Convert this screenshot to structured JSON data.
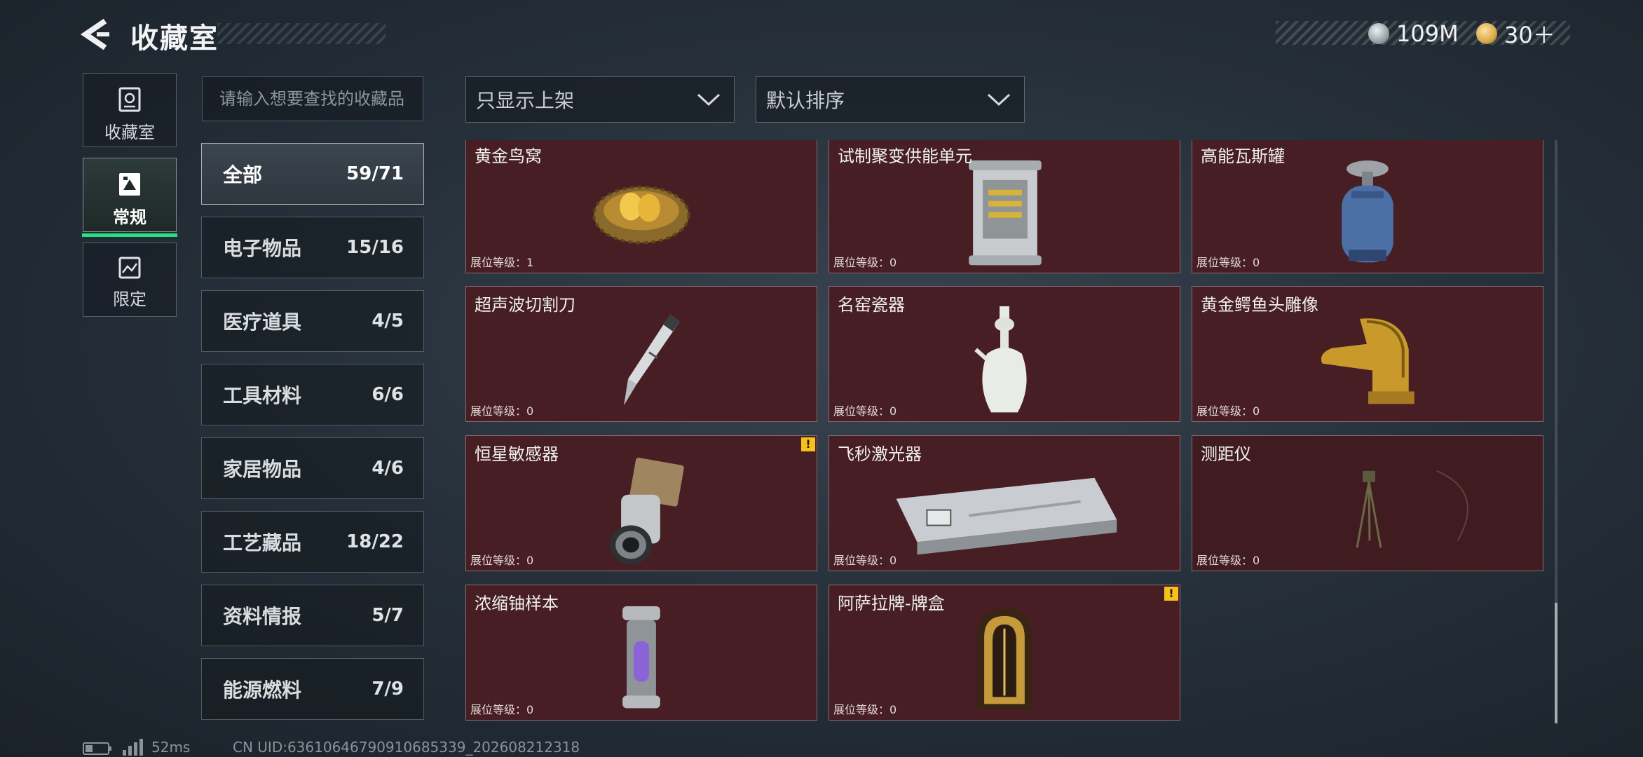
{
  "header": {
    "title": "收藏室"
  },
  "currency": [
    {
      "amount": "109M",
      "icon": "silver-coin-icon",
      "color": "#b9bec4"
    },
    {
      "amount": "30＋",
      "icon": "gold-badge-icon",
      "color": "#d9a84a"
    }
  ],
  "nav": [
    {
      "label": "收藏室",
      "icon": "vault-icon"
    },
    {
      "label": "常规",
      "icon": "picture-frame-icon"
    },
    {
      "label": "限定",
      "icon": "limited-frame-icon"
    }
  ],
  "search": {
    "placeholder": "请输入想要查找的收藏品"
  },
  "filters": {
    "display": "只显示上架",
    "sort": "默认排序"
  },
  "categories": [
    {
      "name": "全部",
      "count": "59/71"
    },
    {
      "name": "电子物品",
      "count": "15/16"
    },
    {
      "name": "医疗道具",
      "count": "4/5"
    },
    {
      "name": "工具材料",
      "count": "6/6"
    },
    {
      "name": "家居物品",
      "count": "4/6"
    },
    {
      "name": "工艺藏品",
      "count": "18/22"
    },
    {
      "name": "资料情报",
      "count": "5/7"
    },
    {
      "name": "能源燃料",
      "count": "7/9"
    }
  ],
  "items": [
    {
      "name": "黄金鸟窝",
      "level": "展位等级：1"
    },
    {
      "name": "试制聚变供能单元",
      "level": "展位等级：0"
    },
    {
      "name": "高能瓦斯罐",
      "level": "展位等级：0"
    },
    {
      "name": "超声波切割刀",
      "level": "展位等级：0"
    },
    {
      "name": "名窑瓷器",
      "level": "展位等级：0"
    },
    {
      "name": "黄金鳄鱼头雕像",
      "level": "展位等级：0"
    },
    {
      "name": "恒星敏感器",
      "level": "展位等级：0",
      "alert": "!"
    },
    {
      "name": "飞秒激光器",
      "level": "展位等级：0"
    },
    {
      "name": "测距仪",
      "level": "展位等级：0"
    },
    {
      "name": "浓缩铀样本",
      "level": "展位等级：0"
    },
    {
      "name": "阿萨拉牌-牌盒",
      "level": "展位等级：0",
      "alert": "!"
    }
  ],
  "footer": {
    "ping": "52ms",
    "uid": "CN UID:63610646790910685339_202608212318"
  },
  "colors": {
    "accent": "#27e07f",
    "card_bg": "#471e24",
    "alert": "#f4c21b"
  }
}
